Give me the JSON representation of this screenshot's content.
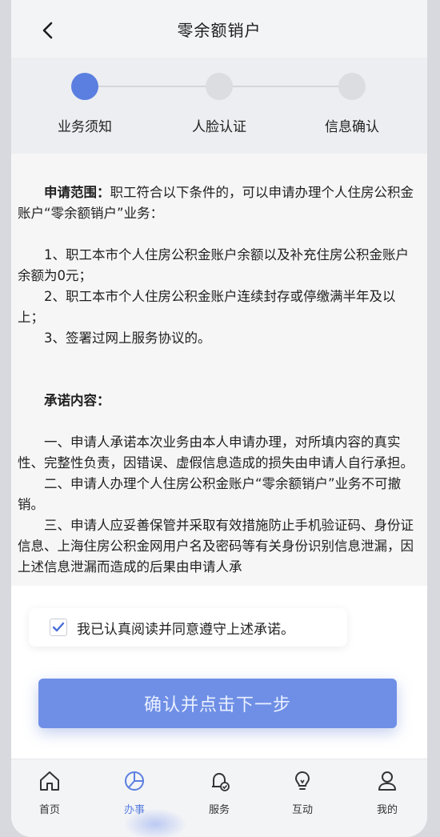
{
  "header": {
    "title": "零余额销户"
  },
  "steps": [
    {
      "label": "业务须知",
      "active": true
    },
    {
      "label": "人脸认证",
      "active": false
    },
    {
      "label": "信息确认",
      "active": false
    }
  ],
  "content": {
    "scope_title": "申请范围：",
    "scope_text": "职工符合以下条件的，可以申请办理个人住房公积金账户“零余额销户”业务：",
    "conditions": [
      "1、职工本市个人住房公积金账户余额以及补充住房公积金账户余额为0元；",
      "2、职工本市个人住房公积金账户连续封存或停缴满半年及以上；",
      "3、签署过网上服务协议的。"
    ],
    "promise_title": "承诺内容：",
    "promises": [
      "一、申请人承诺本次业务由本人申请办理，对所填内容的真实性、完整性负责，因错误、虚假信息造成的损失由申请人自行承担。",
      "二、申请人办理个人住房公积金账户“零余额销户”业务不可撤销。",
      "三、申请人应妥善保管并采取有效措施防止手机验证码、身份证信息、上海住房公积金网用户名及密码等有关身份识别信息泄漏，因上述信息泄漏而造成的后果由申请人承"
    ]
  },
  "agreement": {
    "text": "我已认真阅读并同意遵守上述承诺。",
    "checked": true
  },
  "confirm_button": {
    "label": "确认并点击下一步"
  },
  "nav": [
    {
      "label": "首页",
      "icon": "home-icon",
      "active": false
    },
    {
      "label": "办事",
      "icon": "pie-chart-icon",
      "active": true
    },
    {
      "label": "服务",
      "icon": "bell-check-icon",
      "active": false
    },
    {
      "label": "互动",
      "icon": "lightbulb-icon",
      "active": false
    },
    {
      "label": "我的",
      "icon": "user-icon",
      "active": false
    }
  ],
  "colors": {
    "accent": "#5b7fe0",
    "button": "#6f8fe6"
  }
}
